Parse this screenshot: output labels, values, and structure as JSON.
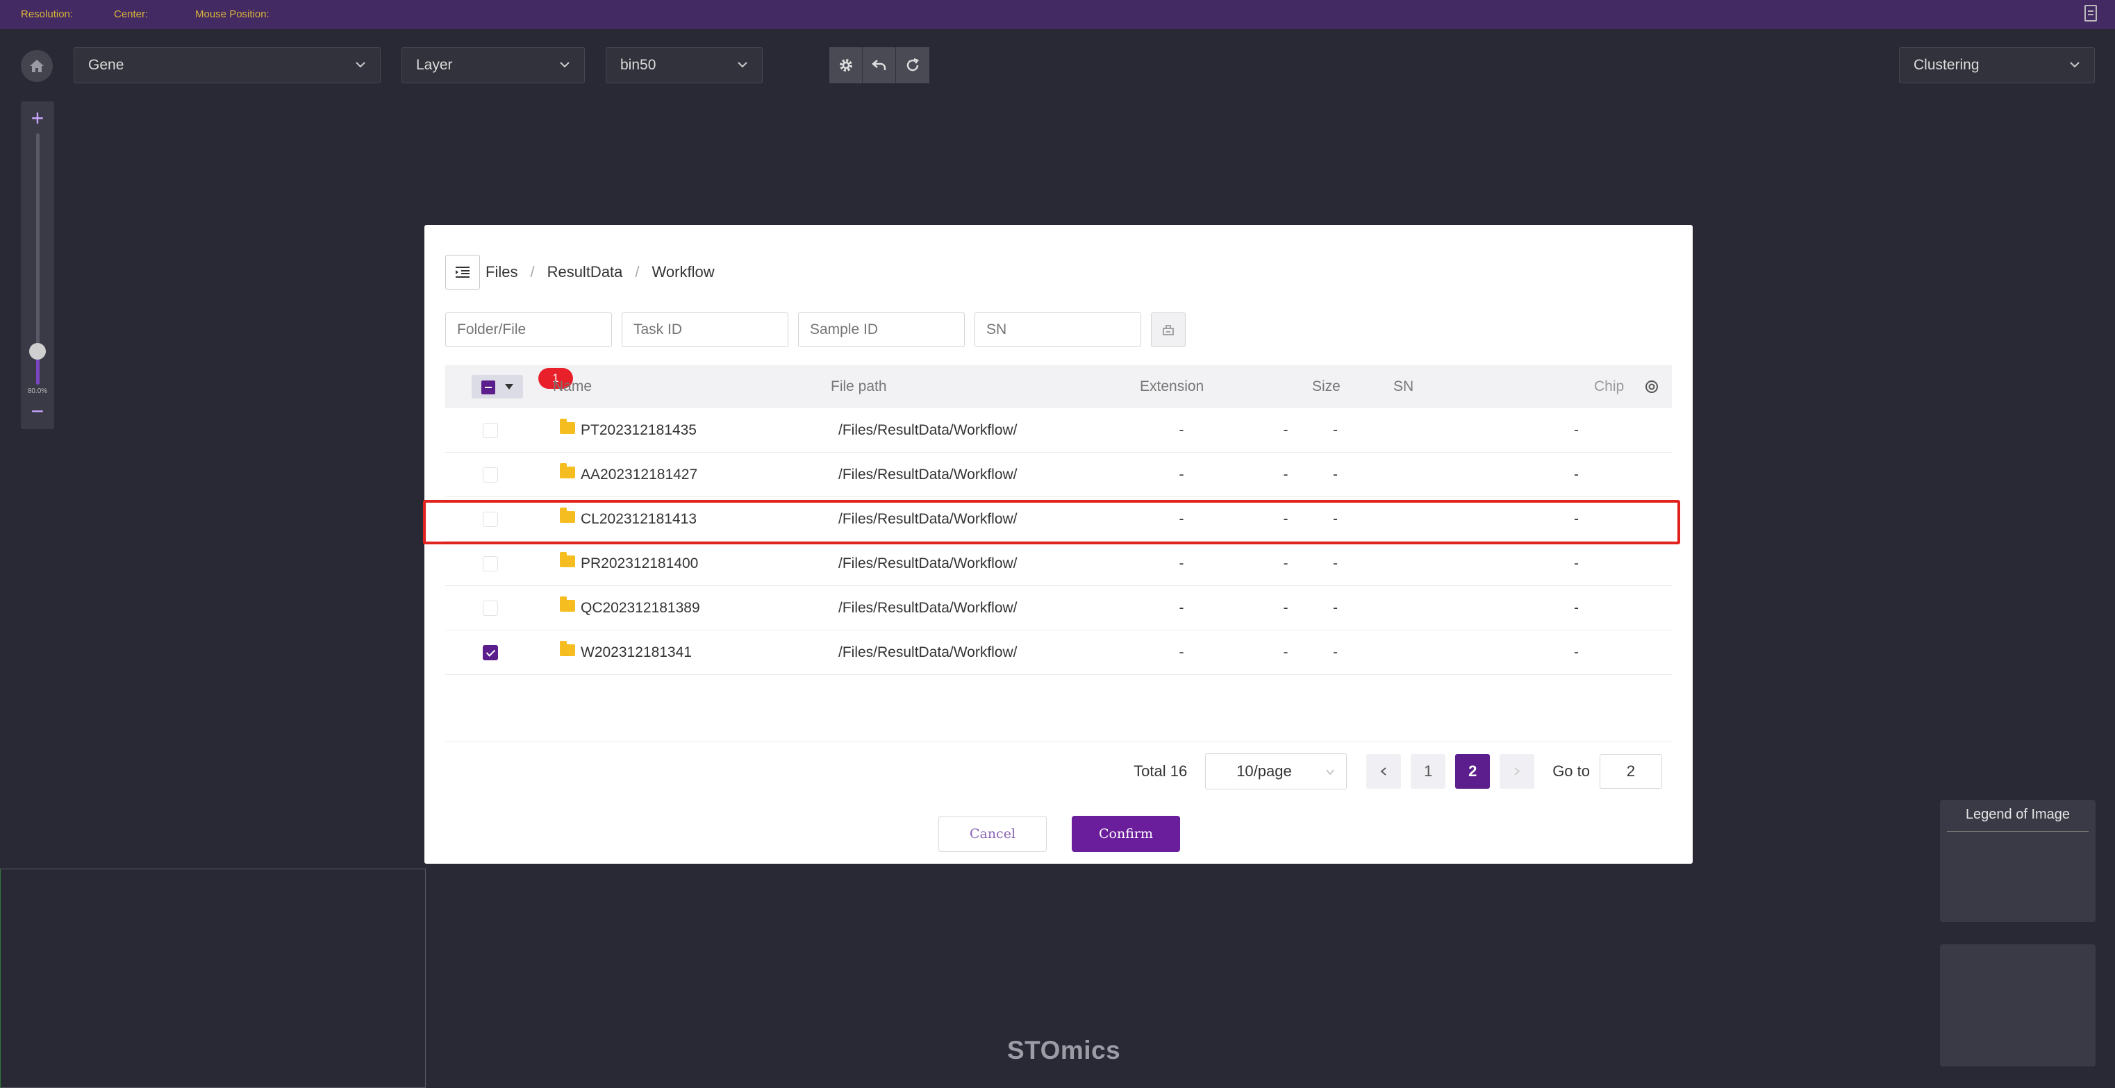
{
  "status_bar": {
    "resolution_label": "Resolution:",
    "center_label": "Center:",
    "mouse_position_label": "Mouse Position:"
  },
  "toolbar": {
    "gene_select": "Gene",
    "layer_select": "Layer",
    "bin_select": "bin50",
    "clustering_select": "Clustering"
  },
  "zoom": {
    "level_label": "80.0%",
    "level": 0.8
  },
  "legend": {
    "title": "Legend of Image"
  },
  "brand": "STOmics",
  "dialog": {
    "breadcrumb": [
      "Files",
      "ResultData",
      "Workflow"
    ],
    "filters": {
      "folder_placeholder": "Folder/File",
      "task_placeholder": "Task ID",
      "sample_placeholder": "Sample ID",
      "sn_placeholder": "SN"
    },
    "selected_count": "1",
    "columns": {
      "name": "Name",
      "path": "File path",
      "ext": "Extension",
      "size": "Size",
      "sn": "SN",
      "chip": "Chip"
    },
    "rows": [
      {
        "name": "PT202312181435",
        "path": "/Files/ResultData/Workflow/",
        "ext": "-",
        "size": "-",
        "sn": "-",
        "chip": "-",
        "checked": false
      },
      {
        "name": "AA202312181427",
        "path": "/Files/ResultData/Workflow/",
        "ext": "-",
        "size": "-",
        "sn": "-",
        "chip": "-",
        "checked": false
      },
      {
        "name": "CL202312181413",
        "path": "/Files/ResultData/Workflow/",
        "ext": "-",
        "size": "-",
        "sn": "-",
        "chip": "-",
        "checked": false
      },
      {
        "name": "PR202312181400",
        "path": "/Files/ResultData/Workflow/",
        "ext": "-",
        "size": "-",
        "sn": "-",
        "chip": "-",
        "checked": false
      },
      {
        "name": "QC202312181389",
        "path": "/Files/ResultData/Workflow/",
        "ext": "-",
        "size": "-",
        "sn": "-",
        "chip": "-",
        "checked": false
      },
      {
        "name": "W202312181341",
        "path": "/Files/ResultData/Workflow/",
        "ext": "-",
        "size": "-",
        "sn": "-",
        "chip": "-",
        "checked": true
      }
    ],
    "pagination": {
      "total": "Total 16",
      "page_size": "10/page",
      "pages": [
        "1",
        "2"
      ],
      "current_page": "2",
      "goto_label": "Go to",
      "goto_value": "2"
    },
    "cancel_label": "Cancel",
    "confirm_label": "Confirm"
  },
  "colors": {
    "accent": "#5b1e8c",
    "topbar": "#442a63",
    "background": "#292935",
    "highlight": "#e0231f"
  }
}
